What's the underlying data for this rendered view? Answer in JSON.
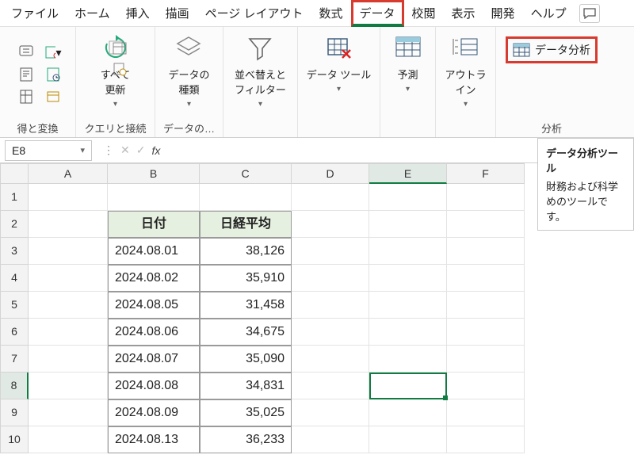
{
  "menu": {
    "items": [
      "ファイル",
      "ホーム",
      "挿入",
      "描画",
      "ページ レイアウト",
      "数式",
      "データ",
      "校閲",
      "表示",
      "開発",
      "ヘルプ"
    ],
    "active_index": 6
  },
  "ribbon": {
    "groups": [
      {
        "label": "得と変換"
      },
      {
        "label": "クエリと接続",
        "refresh_label": "すべて\n更新"
      },
      {
        "label": "データの…",
        "types_label": "データの\n種類"
      },
      {
        "label": "",
        "sort_label": "並べ替えと\nフィルター"
      },
      {
        "label": "",
        "tools_label": "データ ツール"
      },
      {
        "label": "",
        "forecast_label": "予測"
      },
      {
        "label": "",
        "outline_label": "アウトラ\nイン"
      },
      {
        "label": "分析",
        "analysis_btn": "データ分析"
      }
    ]
  },
  "tooltip": {
    "title": "データ分析ツール",
    "body": "財務および科学めのツールです。"
  },
  "formula": {
    "namebox": "E8",
    "fx": "fx"
  },
  "grid": {
    "columns": [
      "A",
      "B",
      "C",
      "D",
      "E",
      "F"
    ],
    "row_numbers": [
      1,
      2,
      3,
      4,
      5,
      6,
      7,
      8,
      9,
      10
    ],
    "headers": {
      "b": "日付",
      "c": "日経平均"
    },
    "data": [
      {
        "b": "2024.08.01",
        "c": "38,126"
      },
      {
        "b": "2024.08.02",
        "c": "35,910"
      },
      {
        "b": "2024.08.05",
        "c": "31,458"
      },
      {
        "b": "2024.08.06",
        "c": "34,675"
      },
      {
        "b": "2024.08.07",
        "c": "35,090"
      },
      {
        "b": "2024.08.08",
        "c": "34,831"
      },
      {
        "b": "2024.08.09",
        "c": "35,025"
      },
      {
        "b": "2024.08.13",
        "c": "36,233"
      }
    ],
    "selected": {
      "row": 8,
      "col": "E"
    }
  }
}
